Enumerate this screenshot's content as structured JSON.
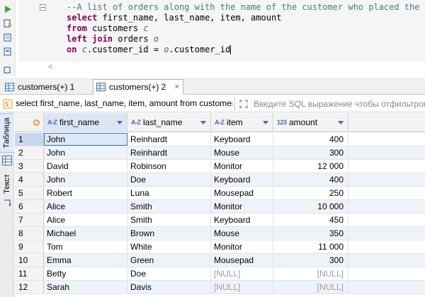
{
  "editor": {
    "lines": [
      {
        "segments": [
          {
            "text": "--A list of orders along with the name of the customer who placed the order.",
            "kind": "comment"
          }
        ]
      },
      {
        "segments": [
          {
            "text": "select",
            "kind": "kw"
          },
          {
            "text": " first_name, last_name, item, amount",
            "kind": "plain"
          }
        ]
      },
      {
        "segments": [
          {
            "text": "from",
            "kind": "kw"
          },
          {
            "text": " customers ",
            "kind": "plain"
          },
          {
            "text": "c",
            "kind": "alias"
          }
        ]
      },
      {
        "segments": [
          {
            "text": "left join",
            "kind": "kw"
          },
          {
            "text": " orders ",
            "kind": "plain"
          },
          {
            "text": "o",
            "kind": "alias"
          }
        ]
      },
      {
        "segments": [
          {
            "text": "on",
            "kind": "kw"
          },
          {
            "text": " ",
            "kind": "plain"
          },
          {
            "text": "c",
            "kind": "alias"
          },
          {
            "text": ".customer_id = ",
            "kind": "plain"
          },
          {
            "text": "o",
            "kind": "alias"
          },
          {
            "text": ".customer_id",
            "kind": "plain"
          }
        ]
      }
    ]
  },
  "tabs": [
    {
      "label": "customers(+) 1",
      "active": false
    },
    {
      "label": "customers(+) 2",
      "active": true,
      "close": "×"
    }
  ],
  "filter": {
    "query": "select first_name, last_name, item, amount from customers c left join orders o on c.customer_id = o.customer_id",
    "placeholder": "Введите SQL выражение чтобы отфильтровать результаты"
  },
  "side": {
    "table_label": "Таблица",
    "text_label": "Текст"
  },
  "grid": {
    "columns": [
      {
        "type": "A-Z",
        "label": "first_name"
      },
      {
        "type": "A-Z",
        "label": "last_name"
      },
      {
        "type": "A-Z",
        "label": "item"
      },
      {
        "type": "123",
        "label": "amount"
      }
    ],
    "rows": [
      {
        "n": "1",
        "first_name": "John",
        "last_name": "Reinhardt",
        "item": "Keyboard",
        "amount": "400"
      },
      {
        "n": "2",
        "first_name": "John",
        "last_name": "Reinhardt",
        "item": "Mouse",
        "amount": "300"
      },
      {
        "n": "3",
        "first_name": "David",
        "last_name": "Robinson",
        "item": "Monitor",
        "amount": "12 000"
      },
      {
        "n": "4",
        "first_name": "John",
        "last_name": "Doe",
        "item": "Keyboard",
        "amount": "400"
      },
      {
        "n": "5",
        "first_name": "Robert",
        "last_name": "Luna",
        "item": "Mousepad",
        "amount": "250"
      },
      {
        "n": "6",
        "first_name": "Alice",
        "last_name": "Smith",
        "item": "Monitor",
        "amount": "10 000"
      },
      {
        "n": "7",
        "first_name": "Alice",
        "last_name": "Smith",
        "item": "Keyboard",
        "amount": "450"
      },
      {
        "n": "8",
        "first_name": "Michael",
        "last_name": "Brown",
        "item": "Mouse",
        "amount": "350"
      },
      {
        "n": "9",
        "first_name": "Tom",
        "last_name": "White",
        "item": "Monitor",
        "amount": "11 000"
      },
      {
        "n": "10",
        "first_name": "Emma",
        "last_name": "Green",
        "item": "Mousepad",
        "amount": "300"
      },
      {
        "n": "11",
        "first_name": "Betty",
        "last_name": "Doe",
        "item": "[NULL]",
        "amount": "[NULL]"
      },
      {
        "n": "12",
        "first_name": "Sarah",
        "last_name": "Davis",
        "item": "[NULL]",
        "amount": "[NULL]"
      }
    ]
  },
  "colors": {
    "keyword": "#7f0055",
    "comment": "#3f7f7f",
    "selection": "#dde8f6",
    "null_text": "#9a9a9a"
  }
}
